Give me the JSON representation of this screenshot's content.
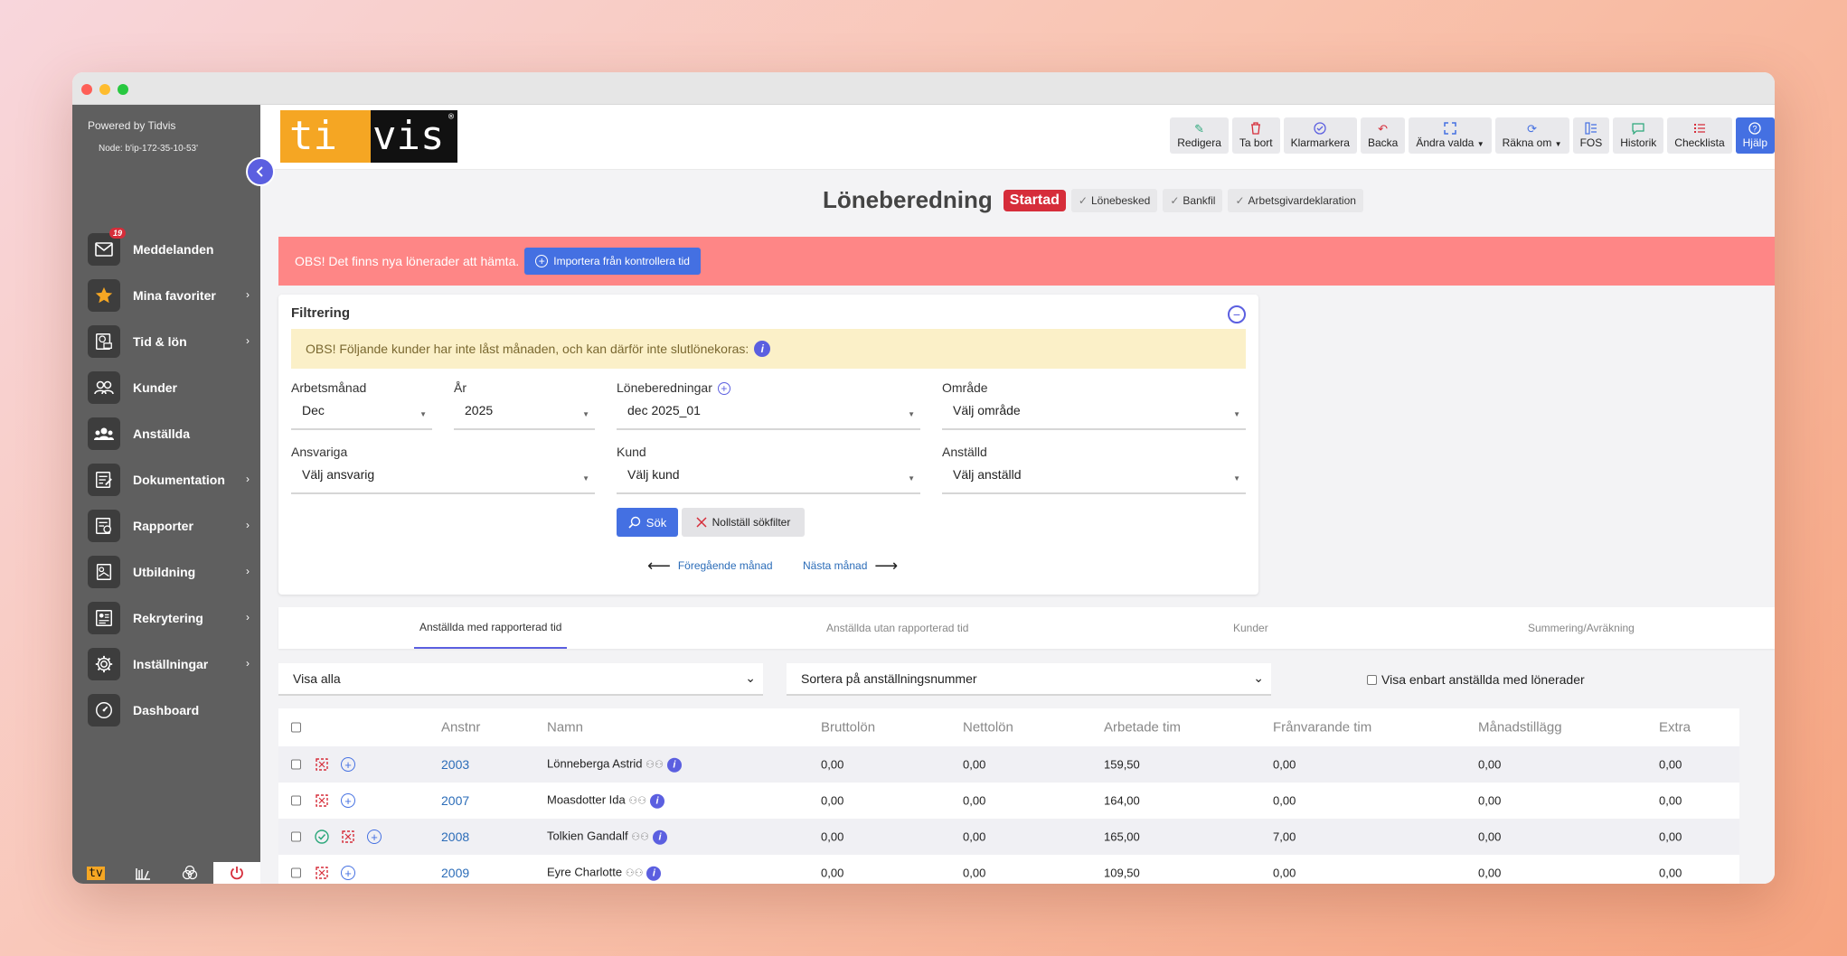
{
  "sidebar": {
    "powered_by": "Powered by Tidvis",
    "node": "Node: b'ip-172-35-10-53'",
    "items": [
      {
        "label": "Meddelanden",
        "badge": "19",
        "arrow": false
      },
      {
        "label": "Mina favoriter",
        "arrow": true
      },
      {
        "label": "Tid & lön",
        "arrow": true
      },
      {
        "label": "Kunder",
        "arrow": false
      },
      {
        "label": "Anställda",
        "arrow": false
      },
      {
        "label": "Dokumentation",
        "arrow": true
      },
      {
        "label": "Rapporter",
        "arrow": true
      },
      {
        "label": "Utbildning",
        "arrow": true
      },
      {
        "label": "Rekrytering",
        "arrow": true
      },
      {
        "label": "Inställningar",
        "arrow": true
      },
      {
        "label": "Dashboard",
        "arrow": false
      }
    ],
    "footer_logo": "tv"
  },
  "logo": {
    "left": "ti",
    "right": "vis",
    "reg": "®"
  },
  "toolbar": {
    "redigera": "Redigera",
    "ta_bort": "Ta bort",
    "klarmarkera": "Klarmarkera",
    "backa": "Backa",
    "andra_valda": "Ändra valda",
    "rakna_om": "Räkna om",
    "fos": "FOS",
    "historik": "Historik",
    "checklista": "Checklista",
    "hjalp": "Hjälp"
  },
  "header": {
    "title": "Löneberedning",
    "status": "Startad",
    "pills": [
      "Lönebesked",
      "Bankfil",
      "Arbetsgivardeklaration"
    ]
  },
  "alert": {
    "text": "OBS! Det finns nya lönerader att hämta.",
    "button": "Importera från kontrollera tid"
  },
  "filter": {
    "title": "Filtrering",
    "warning": "OBS! Följande kunder har inte låst månaden, och kan därför inte slutlönekoras:",
    "arbetsmanad_label": "Arbetsmånad",
    "arbetsmanad_value": "Dec",
    "ar_label": "År",
    "ar_value": "2025",
    "loneberedningar_label": "Löneberedningar",
    "loneberedningar_value": "dec 2025_01",
    "omrade_label": "Område",
    "omrade_value": "Välj område",
    "ansvariga_label": "Ansvariga",
    "ansvariga_value": "Välj ansvarig",
    "kund_label": "Kund",
    "kund_value": "Välj kund",
    "anstalld_label": "Anställd",
    "anstalld_value": "Välj anställd",
    "sok": "Sök",
    "reset": "Nollställ sökfilter",
    "prev_month": "Föregående månad",
    "next_month": "Nästa månad"
  },
  "tabs": [
    {
      "label": "Anställda med rapporterad tid",
      "active": true
    },
    {
      "label": "Anställda utan rapporterad tid",
      "active": false
    },
    {
      "label": "Kunder",
      "active": false
    },
    {
      "label": "Summering/Avräkning",
      "active": false
    }
  ],
  "list_controls": {
    "visa": "Visa alla",
    "sortera": "Sortera på anställningsnummer",
    "checkbox_label": "Visa enbart anställda med lönerader"
  },
  "table": {
    "columns": [
      "Anstnr",
      "Namn",
      "Bruttolön",
      "Nettolön",
      "Arbetade tim",
      "Frånvarande tim",
      "Månadstillägg",
      "Extra"
    ],
    "rows": [
      {
        "anstnr": "2003",
        "namn": "Lönneberga Astrid",
        "brutto": "0,00",
        "netto": "0,00",
        "arbetade": "159,50",
        "franvarande": "0,00",
        "manadstillagg": "0,00",
        "extra": "0,00",
        "approved": false
      },
      {
        "anstnr": "2007",
        "namn": "Moasdotter Ida",
        "brutto": "0,00",
        "netto": "0,00",
        "arbetade": "164,00",
        "franvarande": "0,00",
        "manadstillagg": "0,00",
        "extra": "0,00",
        "approved": false
      },
      {
        "anstnr": "2008",
        "namn": "Tolkien Gandalf",
        "brutto": "0,00",
        "netto": "0,00",
        "arbetade": "165,00",
        "franvarande": "7,00",
        "manadstillagg": "0,00",
        "extra": "0,00",
        "approved": true
      },
      {
        "anstnr": "2009",
        "namn": "Eyre Charlotte",
        "brutto": "0,00",
        "netto": "0,00",
        "arbetade": "109,50",
        "franvarande": "0,00",
        "manadstillagg": "0,00",
        "extra": "0,00",
        "approved": false
      }
    ]
  },
  "colors": {
    "sidebar": "#5f5f5f",
    "accent": "#4470e2",
    "alert": "#fe8686",
    "status_red": "#d62d3a",
    "logo_orange": "#f5a623"
  }
}
